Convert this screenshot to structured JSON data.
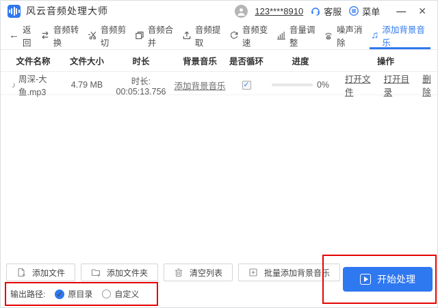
{
  "titlebar": {
    "app_title": "风云音频处理大师",
    "app_icon": "audio-bars-icon",
    "account": "123****8910",
    "support_label": "客服",
    "support_icon": "headset-icon",
    "menu_label": "菜单",
    "menu_icon": "circled-menu-icon",
    "minimize_glyph": "—",
    "close_glyph": "✕"
  },
  "toolbar": {
    "items": [
      {
        "label": "返回",
        "icon": "back-arrow-icon",
        "active": false
      },
      {
        "label": "音频转换",
        "icon": "swap-arrows-icon",
        "active": false
      },
      {
        "label": "音频剪切",
        "icon": "scissors-icon",
        "active": false
      },
      {
        "label": "音频合并",
        "icon": "merge-squares-icon",
        "active": false
      },
      {
        "label": "音频提取",
        "icon": "extract-upload-icon",
        "active": false
      },
      {
        "label": "音频变速",
        "icon": "speed-cycle-icon",
        "active": false
      },
      {
        "label": "音量调整",
        "icon": "volume-bars-icon",
        "active": false
      },
      {
        "label": "噪声消除",
        "icon": "denoise-waves-icon",
        "active": false
      },
      {
        "label": "添加背景音乐",
        "icon": "music-note-icon",
        "active": true
      }
    ],
    "back_glyph": "←",
    "note_glyph": "♫"
  },
  "table": {
    "headers": [
      "文件名称",
      "文件大小",
      "时长",
      "背景音乐",
      "是否循环",
      "进度",
      "操作"
    ],
    "row": {
      "music_glyph": "♪",
      "name": "周深-大鱼.mp3",
      "size": "4.79 MB",
      "duration": "时长: 00:05:13.756",
      "bgm_link": "添加背景音乐",
      "loop_checked": true,
      "check_glyph": "✓",
      "progress_percent": 0,
      "progress_label": "0%",
      "actions": [
        "打开文件",
        "打开目录",
        "删除"
      ]
    }
  },
  "footer": {
    "buttons": [
      {
        "label": "添加文件",
        "icon": "add-file-icon"
      },
      {
        "label": "添加文件夹",
        "icon": "add-folder-icon"
      },
      {
        "label": "清空列表",
        "icon": "trash-icon"
      },
      {
        "label": "批量添加背景音乐",
        "icon": "batch-add-icon"
      }
    ],
    "output_label": "输出路径:",
    "radios": [
      {
        "label": "原目录",
        "selected": true
      },
      {
        "label": "自定义",
        "selected": false
      }
    ],
    "radio_check_glyph": "✓",
    "start_label": "开始处理",
    "start_icon": "play-icon"
  },
  "colors": {
    "accent_blue": "#2e78f0",
    "annotation_red": "#e60202"
  }
}
